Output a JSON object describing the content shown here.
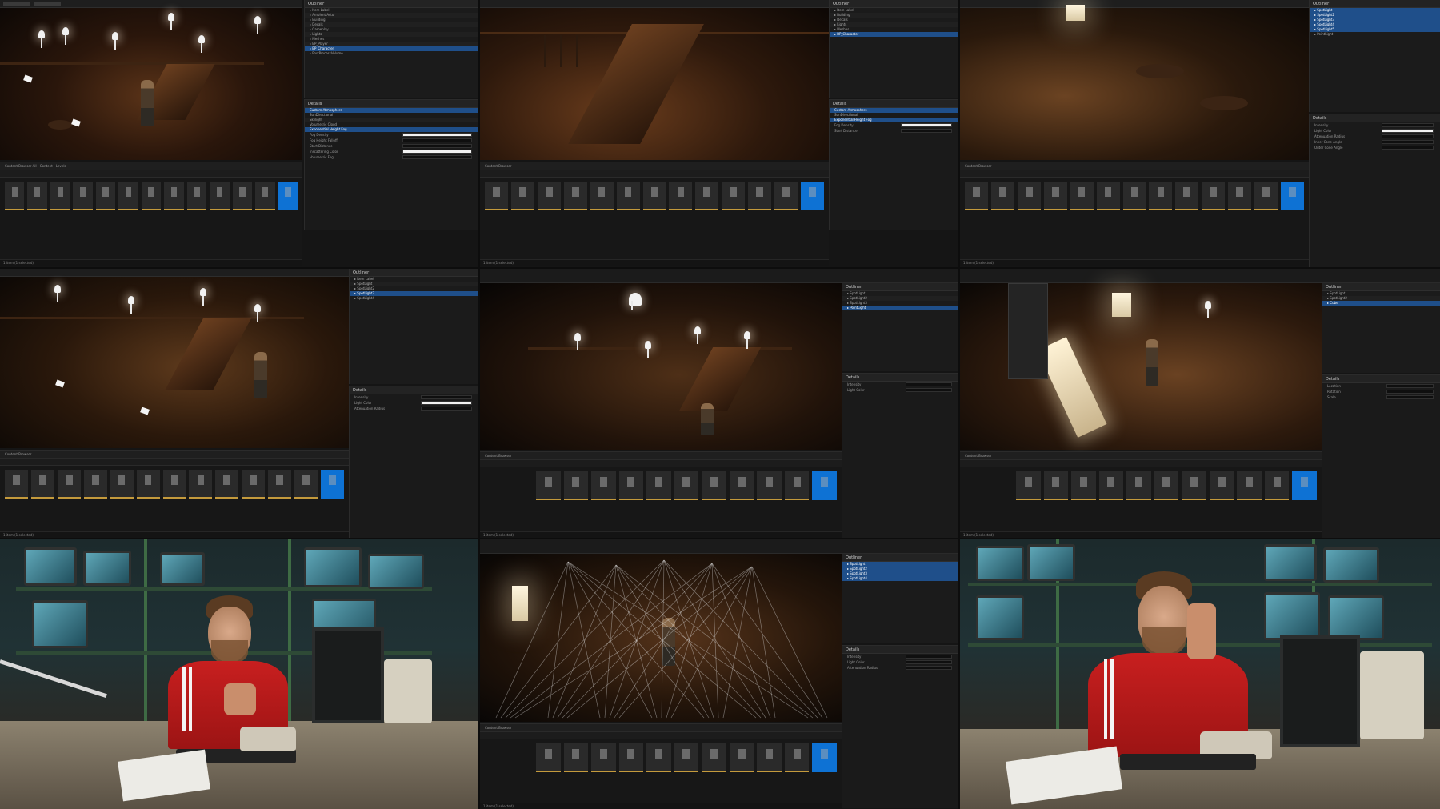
{
  "grid": {
    "frames": [
      {
        "id": "frame-1",
        "kind": "editor"
      },
      {
        "id": "frame-2",
        "kind": "editor"
      },
      {
        "id": "frame-3",
        "kind": "editor"
      },
      {
        "id": "frame-4",
        "kind": "editor"
      },
      {
        "id": "frame-5",
        "kind": "editor"
      },
      {
        "id": "frame-6",
        "kind": "editor"
      },
      {
        "id": "frame-7",
        "kind": "presenter"
      },
      {
        "id": "frame-8",
        "kind": "editor"
      },
      {
        "id": "frame-9",
        "kind": "presenter"
      }
    ]
  },
  "editor": {
    "outliner_title": "Outliner",
    "details_title": "Details",
    "content_browser_title": "Content Browser",
    "settings_label": "Settings",
    "path_crumbs": [
      "All",
      "Content",
      "Levels"
    ],
    "status_text": "1 item (1 selected)",
    "viewport_mode": "Perspective",
    "viewport_lit": "Lit"
  },
  "colors": {
    "selection": "#1f4f8a",
    "thumbnail_selected": "#0e72d4",
    "asset_underline": "#c49a3c",
    "shirt": "#c81f1f"
  }
}
